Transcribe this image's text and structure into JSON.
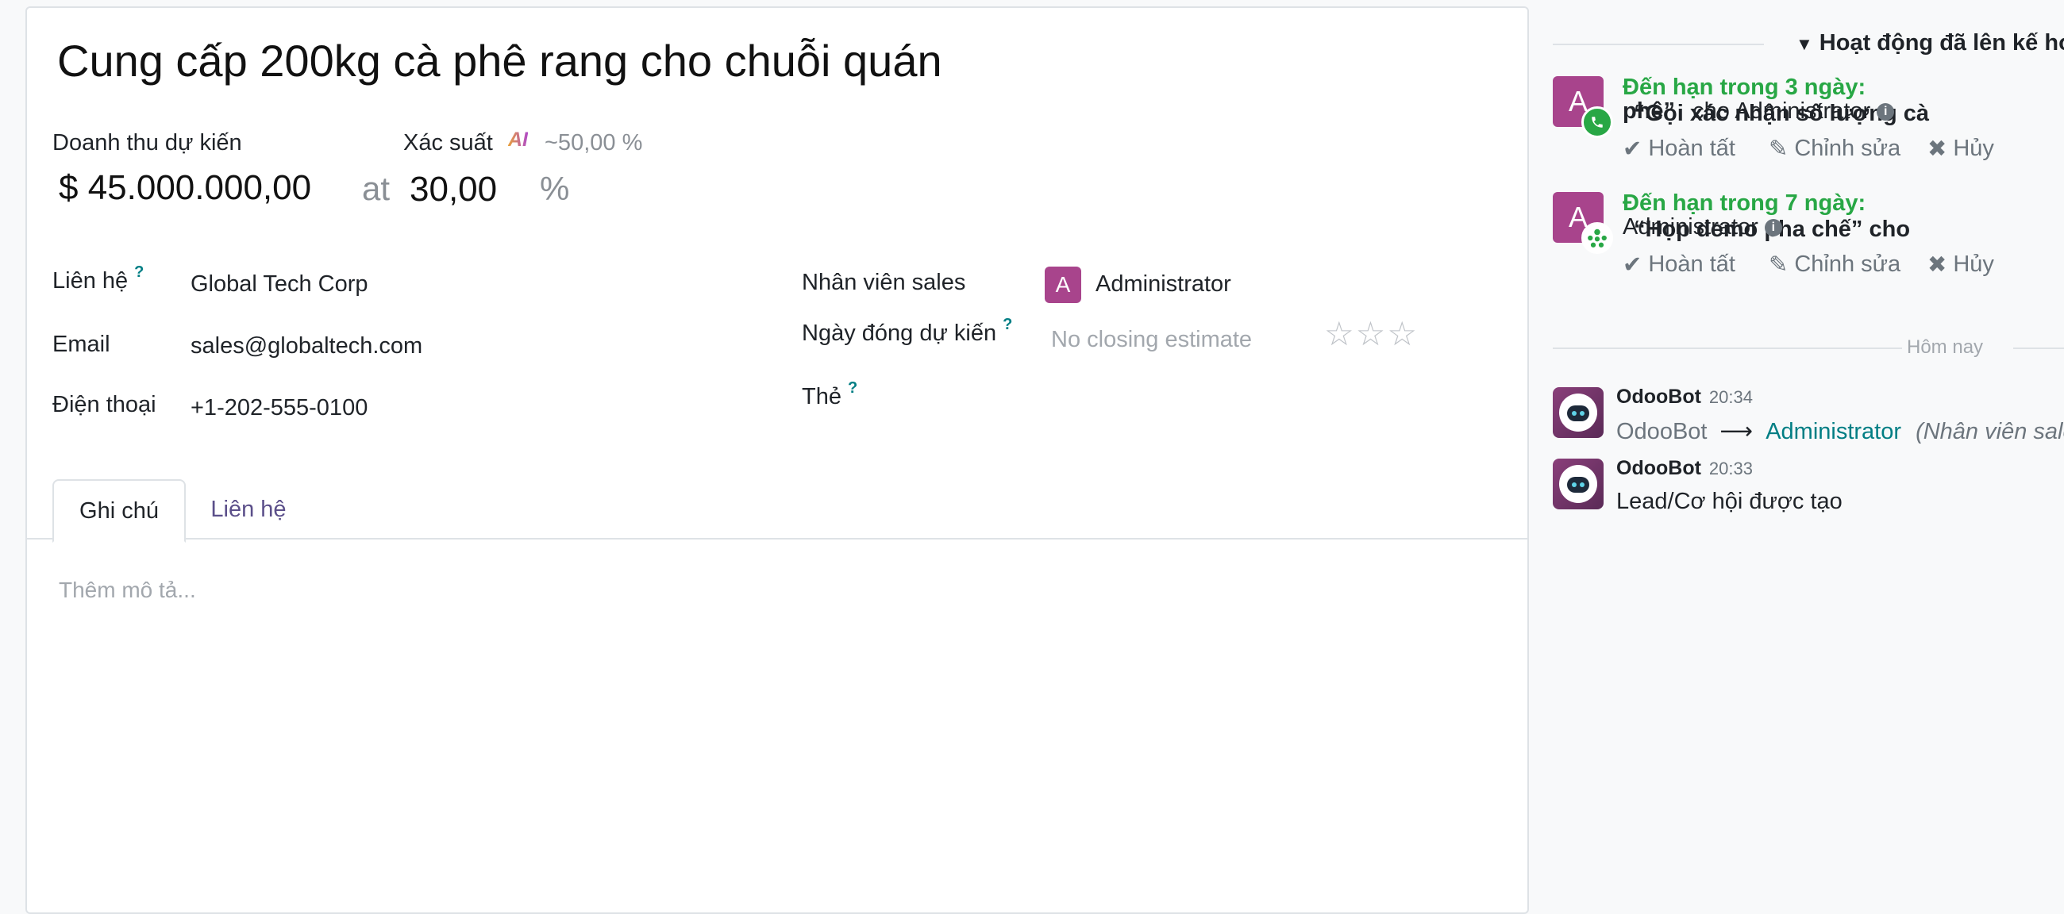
{
  "form": {
    "title": "Cung cấp 200kg cà phê rang cho chuỗi quán",
    "revenue_label": "Doanh thu dự kiến",
    "revenue_value": "$ 45.000.000,00",
    "at_text": "at",
    "probability_value": "30,00",
    "percent_sign": "%",
    "probability_label": "Xác suất",
    "ai_badge": "AI",
    "ai_estimate": "~50,00 %",
    "contact_label": "Liên hệ",
    "contact_value": "Global Tech Corp",
    "email_label": "Email",
    "email_value": "sales@globaltech.com",
    "phone_label": "Điện thoại",
    "phone_value": "+1-202-555-0100",
    "salesperson_label": "Nhân viên sales",
    "salesperson_avatar": "A",
    "salesperson_value": "Administrator",
    "closing_label": "Ngày đóng dự kiến",
    "closing_placeholder": "No closing estimate",
    "priority_stars": 0,
    "tags_label": "Thẻ",
    "help_mark": "?",
    "tabs": [
      {
        "label": "Ghi chú",
        "active": true
      },
      {
        "label": "Liên hệ",
        "active": false
      }
    ],
    "description_placeholder": "Thêm mô tả..."
  },
  "chatter": {
    "planned_header": "Hoạt động đã lên kế hoạch",
    "activities": [
      {
        "avatar": "A",
        "due": "Đến hạn trong 3 ngày:",
        "summary_line1": "“Gọi xác nhận số lượng cà",
        "summary_line2": "phê”",
        "assignee": "cho Administrator",
        "done": "Hoàn tất",
        "edit": "Chỉnh sửa",
        "cancel": "Hủy",
        "type_icon": "phone-icon",
        "type_color": "#28a745"
      },
      {
        "avatar": "A",
        "due": "Đến hạn trong 7 ngày:",
        "summary_line1": "“Họp demo pha chế” cho",
        "assignee": "Administrator",
        "done": "Hoàn tất",
        "edit": "Chỉnh sửa",
        "cancel": "Hủy",
        "type_icon": "meeting-icon",
        "type_color": "#28a745"
      }
    ],
    "date_separator": "Hôm nay",
    "messages": [
      {
        "author": "OdooBot",
        "time": "20:34",
        "from": "OdooBot",
        "arrow": "⟶",
        "to": "Administrator",
        "field": "(Nhân viên sales)"
      },
      {
        "author": "OdooBot",
        "time": "20:33",
        "body": "Lead/Cơ hội được tạo"
      }
    ]
  },
  "colors": {
    "avatar": "#a8448c",
    "due_green": "#28a745",
    "link_teal": "#017e84",
    "tab_inactive": "#5b4f8a"
  }
}
